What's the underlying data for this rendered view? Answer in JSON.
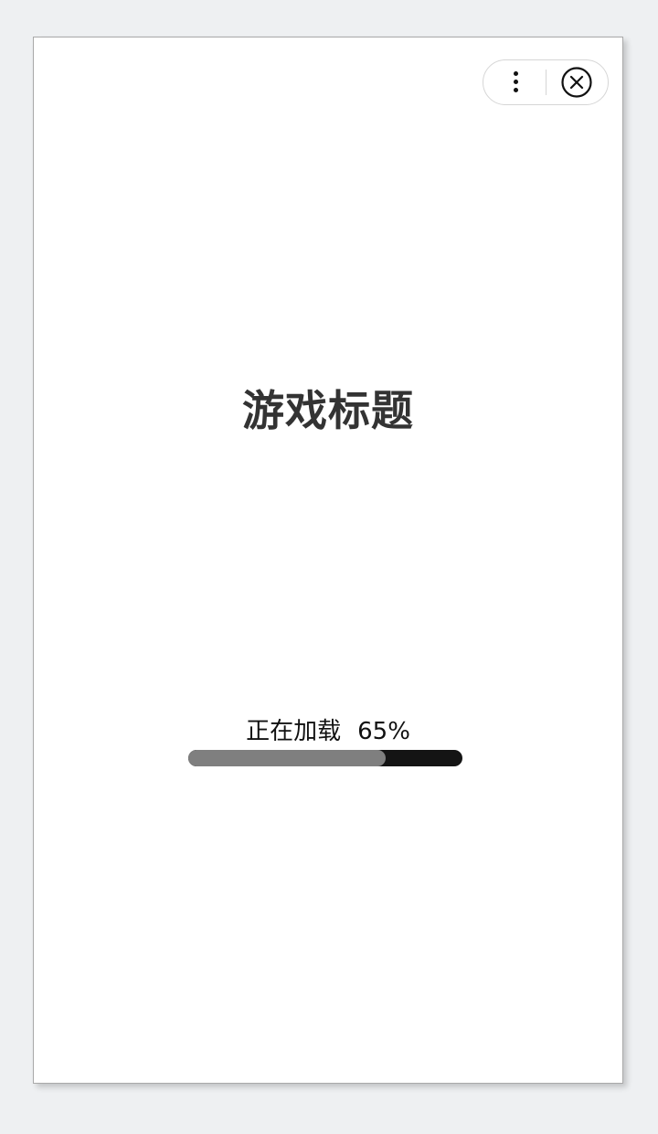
{
  "capsule": {
    "more_icon": "more-vertical-icon",
    "close_icon": "close-circle-icon"
  },
  "game": {
    "title": "游戏标题"
  },
  "loading": {
    "label": "正在加载",
    "percent_text": "65%",
    "progress": 0.72
  },
  "colors": {
    "background": "#eef0f2",
    "title": "#333333",
    "progress_track": "#141414",
    "progress_fill": "#7f7f7f"
  }
}
